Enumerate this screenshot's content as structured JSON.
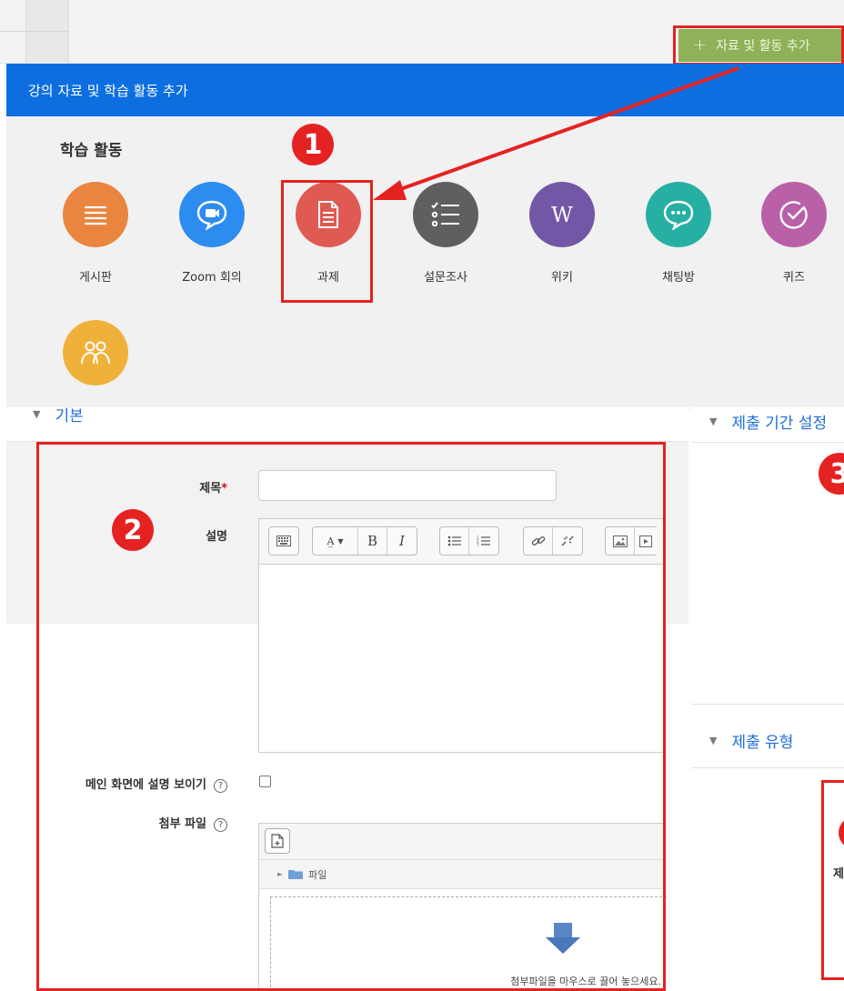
{
  "toolbar": {
    "add_button_label": "자료 및 활동 추가",
    "add_button_icon": "plus-icon"
  },
  "modal": {
    "title": "강의 자료 및 학습 활동 추가",
    "section_title": "학습 활동",
    "activities": [
      {
        "label": "게시판",
        "icon": "list-icon",
        "color": "#e9853f"
      },
      {
        "label": "Zoom 회의",
        "icon": "video-chat-icon",
        "color": "#2d8cf0"
      },
      {
        "label": "과제",
        "icon": "document-icon",
        "color": "#df5a52"
      },
      {
        "label": "설문조사",
        "icon": "checklist-icon",
        "color": "#5f5f5f"
      },
      {
        "label": "위키",
        "icon": "wiki-icon",
        "color": "#7357a7"
      },
      {
        "label": "채팅방",
        "icon": "chat-icon",
        "color": "#26b0a3"
      },
      {
        "label": "퀴즈",
        "icon": "check-circle-icon",
        "color": "#b960a8"
      },
      {
        "label": "",
        "icon": "group-icon",
        "color": "#f0b13a"
      }
    ]
  },
  "annotations": {
    "step1": "1",
    "step2": "2",
    "step3": "3",
    "accent": "#e52222"
  },
  "form": {
    "section_basic": "기본",
    "title_label": "제목",
    "required_mark": "*",
    "description_label": "설명",
    "show_description_label": "메인 화면에 설명 보이기",
    "attachment_label": "첨부 파일",
    "help_glyph": "?",
    "folder_label": "파일",
    "drop_text": "첨부파일을 마우스로 끌어 놓으세요.",
    "editor_buttons": [
      "▦",
      "A̲",
      "B",
      "I",
      "≔",
      "⒈",
      "⛓",
      "⛓̸",
      "▣",
      "▶"
    ]
  },
  "right_panel": {
    "section_deadline": "제출 기간 설정",
    "section_submit_type": "제출 유형",
    "clipped_label": "제"
  },
  "colors": {
    "header_blue": "#0d6ee0",
    "add_button_green": "#8fb158",
    "link_blue": "#1f6fd8"
  }
}
